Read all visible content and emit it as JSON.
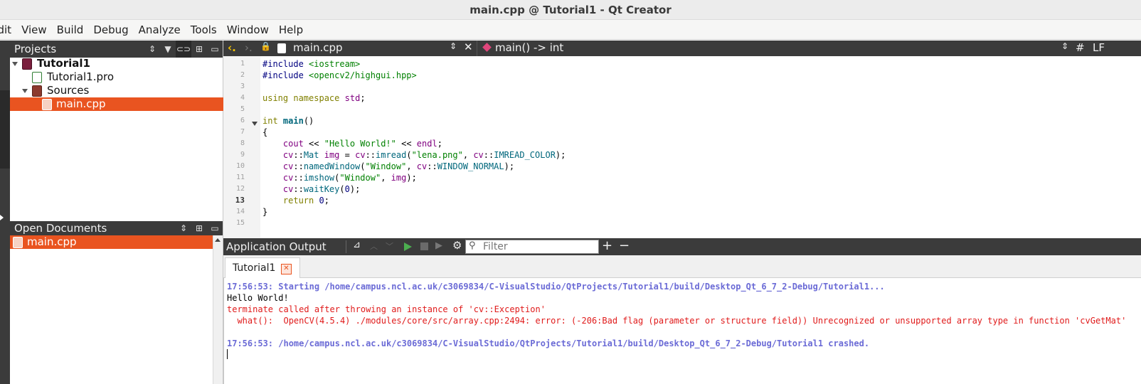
{
  "window": {
    "title": "main.cpp @ Tutorial1 - Qt Creator"
  },
  "menu": [
    "Edit",
    "View",
    "Build",
    "Debug",
    "Analyze",
    "Tools",
    "Window",
    "Help"
  ],
  "projects_panel": {
    "title": "Projects",
    "tree": [
      {
        "label": "Tutorial1",
        "bold": true
      },
      {
        "label": "Tutorial1.pro"
      },
      {
        "label": "Sources"
      },
      {
        "label": "main.cpp",
        "selected": true
      }
    ]
  },
  "open_documents": {
    "title": "Open Documents",
    "items": [
      "main.cpp"
    ]
  },
  "editor": {
    "file": "main.cpp",
    "symbol": "main() -> int",
    "line_ending": "LF",
    "hash": "#",
    "current_line": 13,
    "line_numbers": [
      "1",
      "2",
      "3",
      "4",
      "5",
      "6",
      "7",
      "8",
      "9",
      "10",
      "11",
      "12",
      "13",
      "14",
      "15"
    ],
    "code": [
      "#include <iostream>",
      "#include <opencv2/highgui.hpp>",
      "",
      "using namespace std;",
      "",
      "int main()",
      "{",
      "    cout << \"Hello World!\" << endl;",
      "    cv::Mat img = cv::imread(\"lena.png\", cv::IMREAD_COLOR);",
      "    cv::namedWindow(\"Window\", cv::WINDOW_NORMAL);",
      "    cv::imshow(\"Window\", img);",
      "    cv::waitKey(0);",
      "    return 0;",
      "}",
      ""
    ]
  },
  "output": {
    "title": "Application Output",
    "filter_placeholder": "Filter",
    "tab": "Tutorial1",
    "lines": [
      {
        "kind": "info",
        "text": "17:56:53: Starting /home/campus.ncl.ac.uk/c3069834/C-VisualStudio/QtProjects/Tutorial1/build/Desktop_Qt_6_7_2-Debug/Tutorial1..."
      },
      {
        "kind": "plain",
        "text": "Hello World!"
      },
      {
        "kind": "err",
        "text": "terminate called after throwing an instance of 'cv::Exception'"
      },
      {
        "kind": "err",
        "text": "  what():  OpenCV(4.5.4) ./modules/core/src/array.cpp:2494: error: (-206:Bad flag (parameter or structure field)) Unrecognized or unsupported array type in function 'cvGetMat'"
      },
      {
        "kind": "plain",
        "text": ""
      },
      {
        "kind": "info",
        "text": "17:56:53: /home/campus.ncl.ac.uk/c3069834/C-VisualStudio/QtProjects/Tutorial1/build/Desktop_Qt_6_7_2-Debug/Tutorial1 crashed."
      }
    ]
  },
  "colors": {
    "selection": "#e95420",
    "panel_header": "#3b3b3b",
    "info_text": "#6b6bd6",
    "error_text": "#e01b1b"
  }
}
